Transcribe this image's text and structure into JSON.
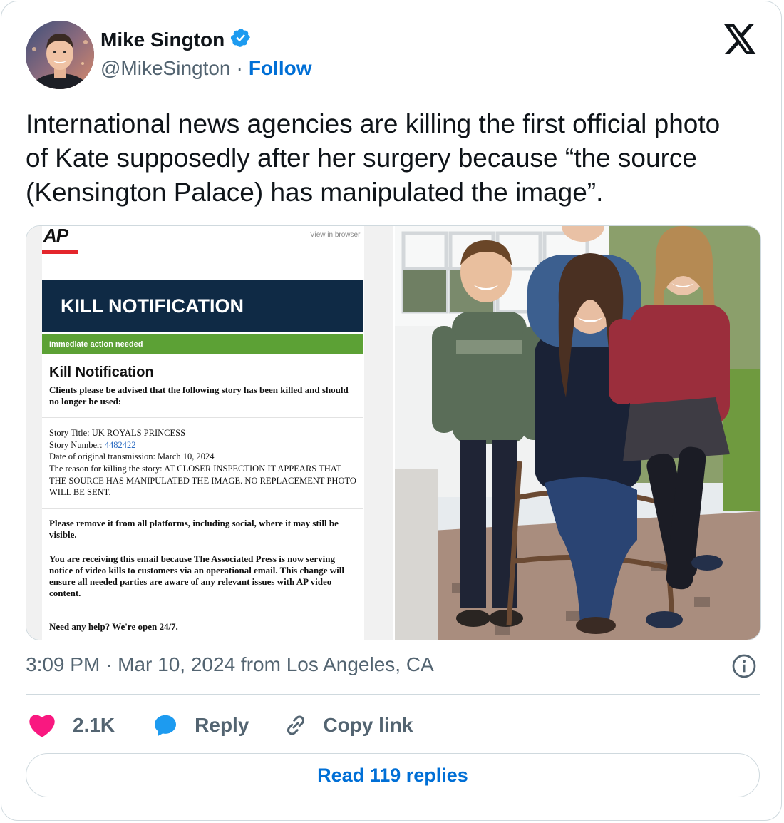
{
  "author": {
    "name": "Mike Sington",
    "handle": "@MikeSington",
    "separator": "·",
    "follow_label": "Follow"
  },
  "tweet": {
    "text": "International news agencies are killing the first official photo of Kate supposedly after her surgery because “the source (Kensington Palace) has manipulated the image”."
  },
  "media_doc": {
    "logo": "AP",
    "view_in_browser": "View in browser",
    "banner": "KILL NOTIFICATION",
    "action_bar": "Immediate action needed",
    "heading": "Kill Notification",
    "intro": "Clients please be advised that the following story has been killed and should no longer be used:",
    "story_title": "Story Title: UK ROYALS PRINCESS",
    "story_number_label": "Story Number: ",
    "story_number": "4482422",
    "transmission": "Date of original transmission: March 10, 2024",
    "reason": "The reason for killing the story: AT CLOSER INSPECTION IT APPEARS THAT THE SOURCE HAS MANIPULATED THE IMAGE. NO REPLACEMENT PHOTO WILL BE SENT.",
    "remove_notice": "Please remove it from all platforms, including social, where it may still be visible.",
    "email_notice": "You are receiving this email because The Associated Press is now serving notice of video kills to customers via an operational email. This change will ensure all needed parties are aware of any relevant issues with AP video content.",
    "help": "Need any help? We're open 24/7."
  },
  "meta": {
    "timestamp": "3:09 PM · Mar 10, 2024 from Los Angeles, CA"
  },
  "actions": {
    "likes": "2.1K",
    "reply_label": "Reply",
    "copy_label": "Copy link"
  },
  "read_replies_label": "Read 119 replies",
  "colors": {
    "accent": "#006fd6",
    "like": "#f91880",
    "reply_icon": "#1d9bf0",
    "verified": "#1d9bf0",
    "banner": "#0f2a45",
    "action_bar": "#5ca135"
  }
}
